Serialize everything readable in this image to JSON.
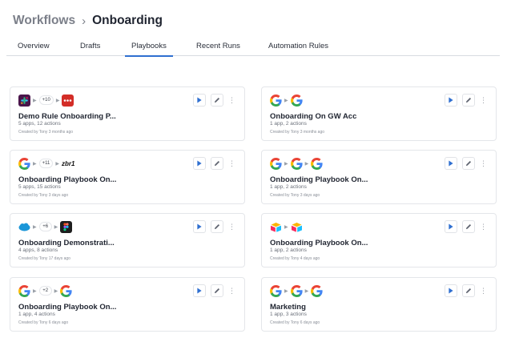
{
  "breadcrumb": {
    "parent": "Workflows",
    "separator": "›",
    "current": "Onboarding"
  },
  "tabs": [
    {
      "label": "Overview"
    },
    {
      "label": "Drafts"
    },
    {
      "label": "Playbooks"
    },
    {
      "label": "Recent Runs"
    },
    {
      "label": "Automation Rules"
    }
  ],
  "cards": [
    {
      "title": "Demo Rule Onboarding P...",
      "sub": "5 apps, 12 actions",
      "created": "Created by Tony 3 months ago",
      "badge": "+10"
    },
    {
      "title": "Onboarding On GW Acc",
      "sub": "1 app, 2 actions",
      "created": "Created by Tony 3 months ago"
    },
    {
      "title": "Onboarding Playbook On...",
      "sub": "5 apps, 15 actions",
      "created": "Created by Tony 3 days ago",
      "badge": "+11",
      "logo_text": "zbr1"
    },
    {
      "title": "Onboarding Playbook On...",
      "sub": "1 app, 2 actions",
      "created": "Created by Tony 3 days ago"
    },
    {
      "title": "Onboarding Demonstrati...",
      "sub": "4 apps, 8 actions",
      "created": "Created by Tony 17 days ago",
      "badge": "+6"
    },
    {
      "title": "Onboarding Playbook On...",
      "sub": "1 app, 2 actions",
      "created": "Created by Tony 4 days ago"
    },
    {
      "title": "Onboarding Playbook On...",
      "sub": "1 app, 4 actions",
      "created": "Created by Tony 6 days ago",
      "badge": "+2"
    },
    {
      "title": "Marketing",
      "sub": "1 app, 3 actions",
      "created": "Created by Tony 6 days ago"
    }
  ],
  "icons": [
    "slack-icon",
    "lastpass-icon",
    "google-icon",
    "salesforce-icon",
    "figma-icon",
    "airtable-icon",
    "play-icon",
    "edit-icon",
    "more-icon"
  ],
  "colors": {
    "accent": "#2f6fd0",
    "google_blue": "#4285F4",
    "google_red": "#EA4335",
    "google_yellow": "#FBBC05",
    "google_green": "#34A853"
  }
}
